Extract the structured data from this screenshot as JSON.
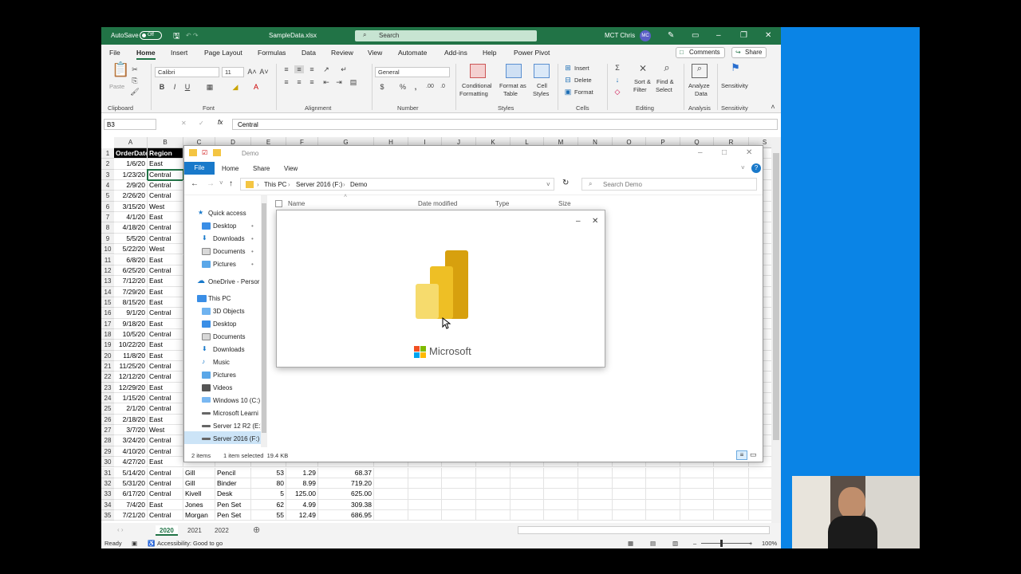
{
  "excel": {
    "autosave_label": "AutoSave",
    "autosave_state": "Off",
    "file_title": "SampleData.xlsx",
    "search_placeholder": "Search",
    "user_name": "MCT Chris",
    "user_initials": "MC",
    "menu": [
      "File",
      "Home",
      "Insert",
      "Page Layout",
      "Formulas",
      "Data",
      "Review",
      "View",
      "Automate",
      "Add-ins",
      "Help",
      "Power Pivot"
    ],
    "comments_label": "Comments",
    "share_label": "Share",
    "ribbon": {
      "paste": "Paste",
      "clipboard": "Clipboard",
      "font_name": "Calibri",
      "font_size": "11",
      "font_group": "Font",
      "alignment_group": "Alignment",
      "number_format": "General",
      "number_group": "Number",
      "cond_fmt_1": "Conditional",
      "cond_fmt_2": "Formatting",
      "fmt_table_1": "Format as",
      "fmt_table_2": "Table",
      "cell_styles_1": "Cell",
      "cell_styles_2": "Styles",
      "styles_group": "Styles",
      "insert": "Insert",
      "delete": "Delete",
      "format": "Format",
      "cells_group": "Cells",
      "sort_1": "Sort &",
      "sort_2": "Filter",
      "find_1": "Find &",
      "find_2": "Select",
      "editing_group": "Editing",
      "analyze_1": "Analyze",
      "analyze_2": "Data",
      "analysis_group": "Analysis",
      "sensitivity": "Sensitivity",
      "sensitivity_group": "Sensitivity"
    },
    "name_box": "B3",
    "fx_label": "fx",
    "formula": "Central",
    "columns": [
      "A",
      "B",
      "C",
      "D",
      "E",
      "F",
      "G",
      "H",
      "I",
      "J",
      "K",
      "L",
      "M",
      "N",
      "O",
      "P",
      "Q",
      "R",
      "S"
    ],
    "header_row": {
      "a": "OrderDate",
      "b": "Region"
    },
    "rows": [
      {
        "n": "1"
      },
      {
        "n": "2",
        "a": "1/6/20",
        "b": "East"
      },
      {
        "n": "3",
        "a": "1/23/20",
        "b": "Central"
      },
      {
        "n": "4",
        "a": "2/9/20",
        "b": "Central"
      },
      {
        "n": "5",
        "a": "2/26/20",
        "b": "Central"
      },
      {
        "n": "6",
        "a": "3/15/20",
        "b": "West"
      },
      {
        "n": "7",
        "a": "4/1/20",
        "b": "East"
      },
      {
        "n": "8",
        "a": "4/18/20",
        "b": "Central"
      },
      {
        "n": "9",
        "a": "5/5/20",
        "b": "Central"
      },
      {
        "n": "10",
        "a": "5/22/20",
        "b": "West"
      },
      {
        "n": "11",
        "a": "6/8/20",
        "b": "East"
      },
      {
        "n": "12",
        "a": "6/25/20",
        "b": "Central"
      },
      {
        "n": "13",
        "a": "7/12/20",
        "b": "East"
      },
      {
        "n": "14",
        "a": "7/29/20",
        "b": "East"
      },
      {
        "n": "15",
        "a": "8/15/20",
        "b": "East"
      },
      {
        "n": "16",
        "a": "9/1/20",
        "b": "Central"
      },
      {
        "n": "17",
        "a": "9/18/20",
        "b": "East"
      },
      {
        "n": "18",
        "a": "10/5/20",
        "b": "Central"
      },
      {
        "n": "19",
        "a": "10/22/20",
        "b": "East"
      },
      {
        "n": "20",
        "a": "11/8/20",
        "b": "East"
      },
      {
        "n": "21",
        "a": "11/25/20",
        "b": "Central"
      },
      {
        "n": "22",
        "a": "12/12/20",
        "b": "Central"
      },
      {
        "n": "23",
        "a": "12/29/20",
        "b": "East"
      },
      {
        "n": "24",
        "a": "1/15/20",
        "b": "Central"
      },
      {
        "n": "25",
        "a": "2/1/20",
        "b": "Central"
      },
      {
        "n": "26",
        "a": "2/18/20",
        "b": "East"
      },
      {
        "n": "27",
        "a": "3/7/20",
        "b": "West"
      },
      {
        "n": "28",
        "a": "3/24/20",
        "b": "Central"
      },
      {
        "n": "29",
        "a": "4/10/20",
        "b": "Central"
      },
      {
        "n": "30",
        "a": "4/27/20",
        "b": "East"
      },
      {
        "n": "31",
        "a": "5/14/20",
        "b": "Central",
        "c": "Gill",
        "d": "Pencil",
        "e": "53",
        "f": "1.29",
        "g": "68.37"
      },
      {
        "n": "32",
        "a": "5/31/20",
        "b": "Central",
        "c": "Gill",
        "d": "Binder",
        "e": "80",
        "f": "8.99",
        "g": "719.20"
      },
      {
        "n": "33",
        "a": "6/17/20",
        "b": "Central",
        "c": "Kivell",
        "d": "Desk",
        "e": "5",
        "f": "125.00",
        "g": "625.00"
      },
      {
        "n": "34",
        "a": "7/4/20",
        "b": "East",
        "c": "Jones",
        "d": "Pen Set",
        "e": "62",
        "f": "4.99",
        "g": "309.38"
      },
      {
        "n": "35",
        "a": "7/21/20",
        "b": "Central",
        "c": "Morgan",
        "d": "Pen Set",
        "e": "55",
        "f": "12.49",
        "g": "686.95"
      }
    ],
    "sheets": [
      "2020",
      "2021",
      "2022"
    ],
    "status_ready": "Ready",
    "accessibility": "Accessibility: Good to go",
    "zoom": "100%"
  },
  "explorer": {
    "title": "Demo",
    "tabs": [
      "File",
      "Home",
      "Share",
      "View"
    ],
    "breadcrumb": [
      "This PC",
      "Server 2016 (F:)",
      "Demo"
    ],
    "search_placeholder": "Search Demo",
    "columns": [
      "Name",
      "Date modified",
      "Type",
      "Size"
    ],
    "quick_access_label": "Quick access",
    "quick_access": [
      "Desktop",
      "Downloads",
      "Documents",
      "Pictures"
    ],
    "onedrive": "OneDrive - Persor",
    "this_pc_label": "This PC",
    "this_pc": [
      "3D Objects",
      "Desktop",
      "Documents",
      "Downloads",
      "Music",
      "Pictures",
      "Videos",
      "Windows 10 (C:)",
      "Microsoft Learni",
      "Server 12 R2 (E:)",
      "Server 2016 (F:)"
    ],
    "items_count": "2 items",
    "selection": "1 item selected  19.4 KB"
  },
  "splash": {
    "brand": "Microsoft"
  }
}
